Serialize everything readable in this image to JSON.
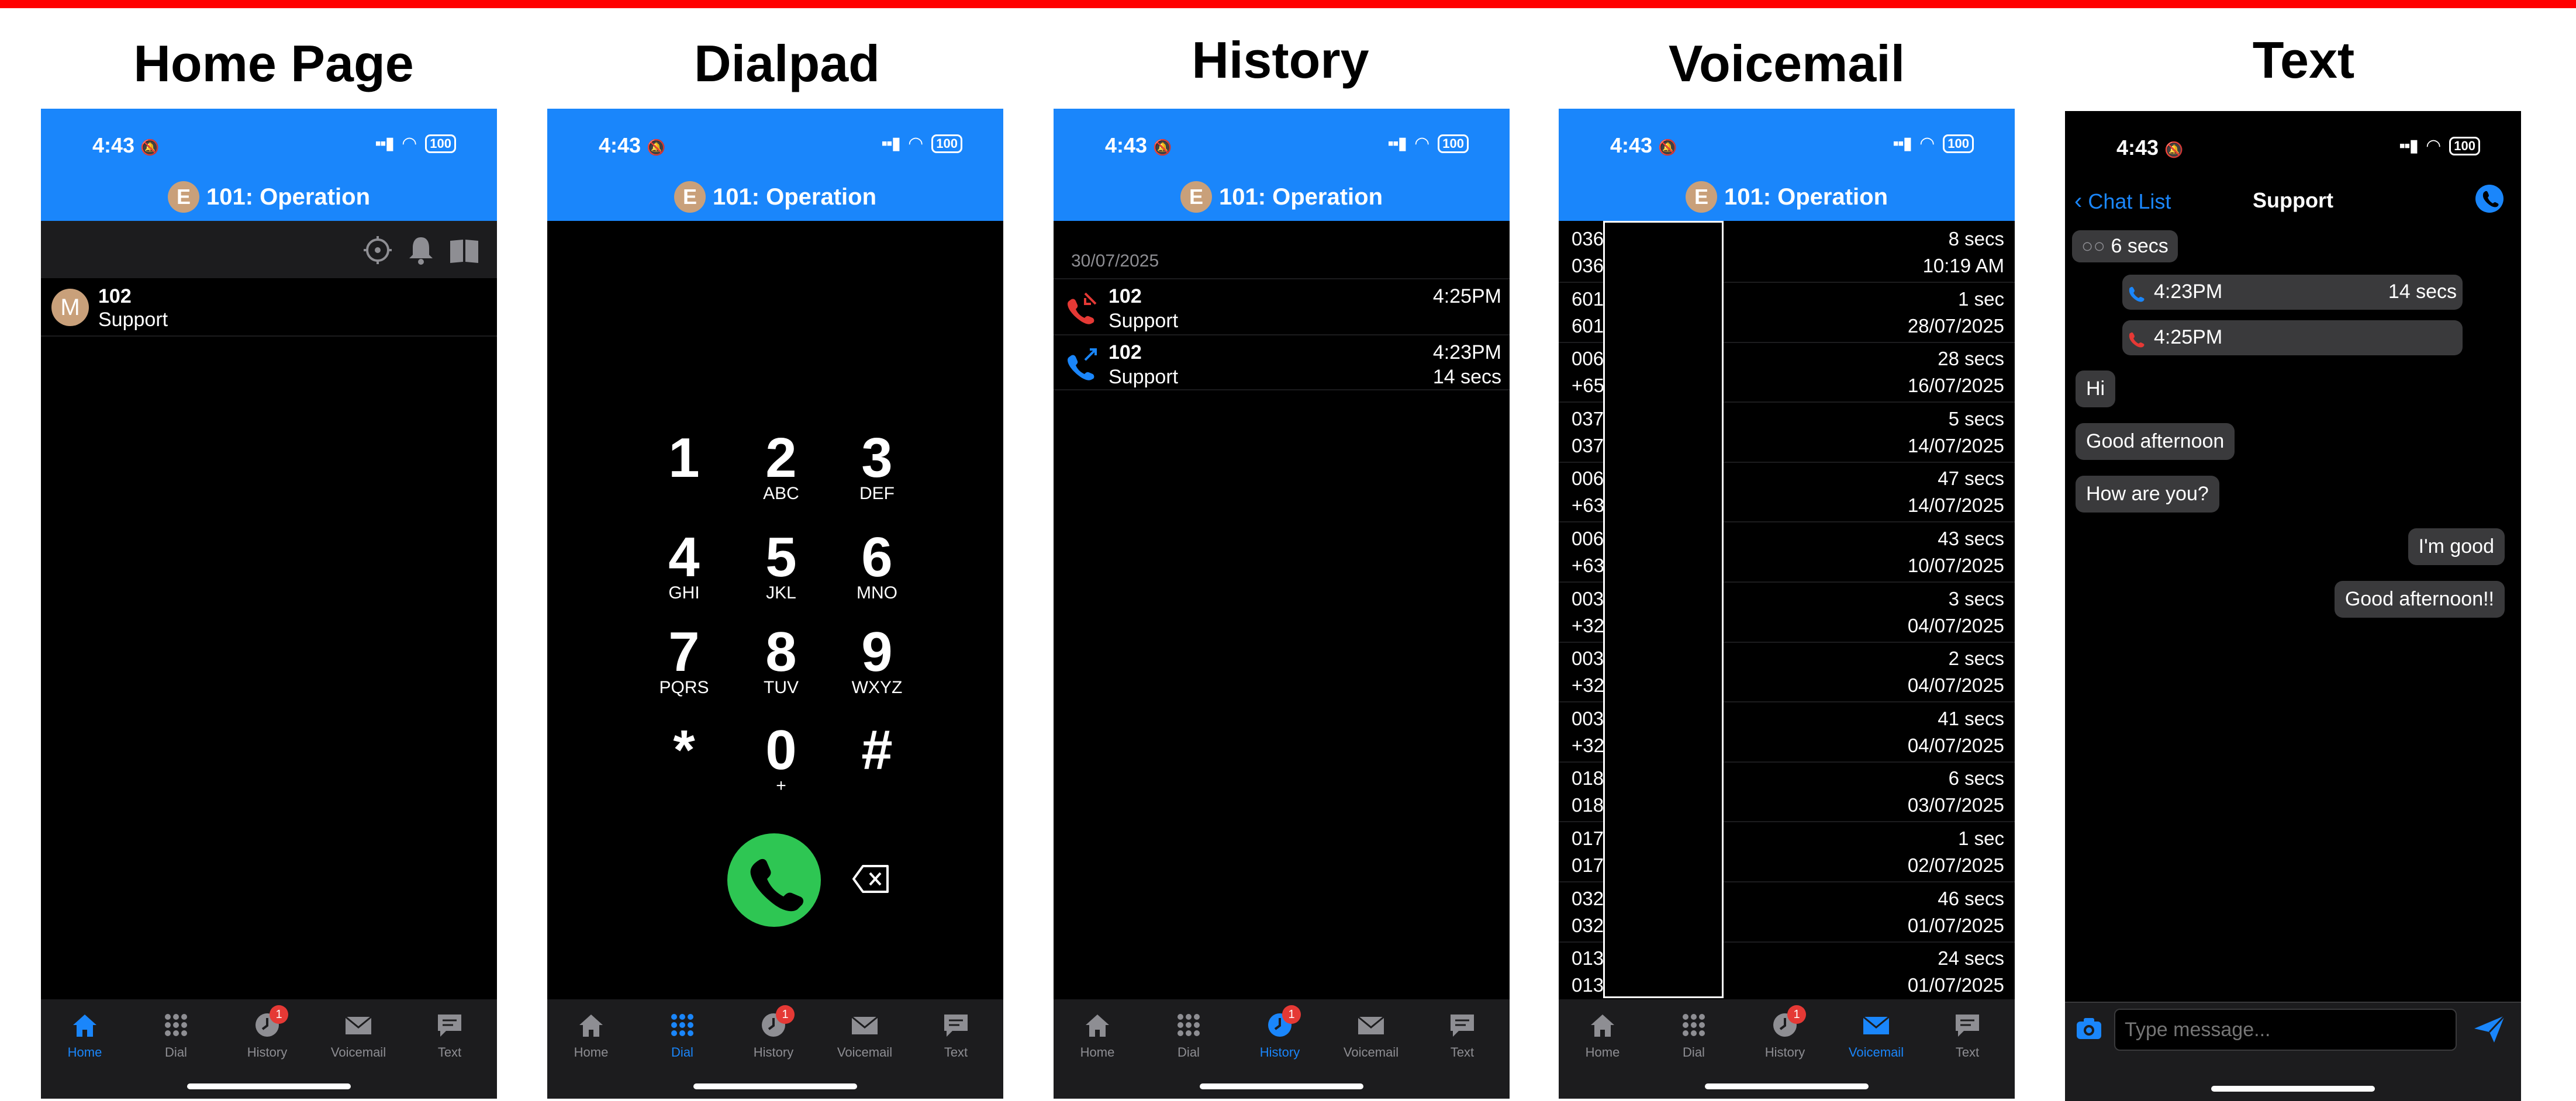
{
  "titles": [
    "Home Page",
    "Dialpad",
    "History",
    "Voicemail",
    "Text"
  ],
  "status": {
    "time": "4:43",
    "battery": "100"
  },
  "account": {
    "badge": "E",
    "label": "101: Operation"
  },
  "tabs": [
    {
      "label": "Home",
      "icon": "home-icon"
    },
    {
      "label": "Dial",
      "icon": "grid-icon"
    },
    {
      "label": "History",
      "icon": "clock-icon",
      "badge": "1"
    },
    {
      "label": "Voicemail",
      "icon": "envelope-icon"
    },
    {
      "label": "Text",
      "icon": "chat-icon"
    }
  ],
  "home": {
    "toolbar_icons": [
      "settings-icon",
      "bell-icon",
      "book-icon"
    ],
    "contact": {
      "avatar": "M",
      "number": "102",
      "name": "Support"
    }
  },
  "dialpad": {
    "keys": [
      {
        "d": "1",
        "l": ""
      },
      {
        "d": "2",
        "l": "ABC"
      },
      {
        "d": "3",
        "l": "DEF"
      },
      {
        "d": "4",
        "l": "GHI"
      },
      {
        "d": "5",
        "l": "JKL"
      },
      {
        "d": "6",
        "l": "MNO"
      },
      {
        "d": "7",
        "l": "PQRS"
      },
      {
        "d": "8",
        "l": "TUV"
      },
      {
        "d": "9",
        "l": "WXYZ"
      },
      {
        "d": "*",
        "l": ""
      },
      {
        "d": "0",
        "l": "+"
      },
      {
        "d": "#",
        "l": ""
      }
    ]
  },
  "history": {
    "date": "30/07/2025",
    "rows": [
      {
        "type": "missed",
        "number": "102",
        "name": "Support",
        "time": "4:25PM",
        "duration": ""
      },
      {
        "type": "outgoing",
        "number": "102",
        "name": "Support",
        "time": "4:23PM",
        "duration": "14 secs"
      }
    ],
    "colors": {
      "missed": "#e53935",
      "outgoing": "#1a86fb"
    }
  },
  "voicemail": {
    "rows": [
      {
        "a": "036",
        "b": "036",
        "duration": "8 secs",
        "date": "10:19 AM"
      },
      {
        "a": "601",
        "b": "601",
        "duration": "1 sec",
        "date": "28/07/2025"
      },
      {
        "a": "006",
        "b": "+65",
        "duration": "28 secs",
        "date": "16/07/2025"
      },
      {
        "a": "037",
        "b": "037",
        "duration": "5 secs",
        "date": "14/07/2025"
      },
      {
        "a": "006",
        "b": "+63",
        "duration": "47 secs",
        "date": "14/07/2025"
      },
      {
        "a": "006",
        "b": "+63",
        "duration": "43 secs",
        "date": "10/07/2025"
      },
      {
        "a": "003",
        "b": "+32",
        "duration": "3 secs",
        "date": "04/07/2025"
      },
      {
        "a": "003",
        "b": "+32",
        "duration": "2 secs",
        "date": "04/07/2025"
      },
      {
        "a": "003",
        "b": "+32",
        "duration": "41 secs",
        "date": "04/07/2025"
      },
      {
        "a": "018",
        "b": "018",
        "duration": "6 secs",
        "date": "03/07/2025"
      },
      {
        "a": "017",
        "b": "017",
        "duration": "1 sec",
        "date": "02/07/2025"
      },
      {
        "a": "032",
        "b": "032",
        "duration": "46 secs",
        "date": "01/07/2025"
      },
      {
        "a": "013",
        "b": "013",
        "duration": "24 secs",
        "date": "01/07/2025"
      }
    ]
  },
  "text": {
    "back_label": "Chat List",
    "title": "Support",
    "voicemail_pill": "6 secs",
    "calls": [
      {
        "type": "outgoing",
        "time": "4:23PM",
        "duration": "14 secs"
      },
      {
        "type": "missed",
        "time": "4:25PM",
        "duration": ""
      }
    ],
    "messages": [
      {
        "side": "left",
        "text": "Hi"
      },
      {
        "side": "left",
        "text": "Good afternoon"
      },
      {
        "side": "left",
        "text": "How are you?"
      },
      {
        "side": "right",
        "text": "I'm good"
      },
      {
        "side": "right",
        "text": "Good afternoon!!"
      }
    ],
    "input_placeholder": "Type message..."
  },
  "colors": {
    "accent": "#1a86fb",
    "call_green": "#2ec653",
    "badge_red": "#e53935"
  }
}
